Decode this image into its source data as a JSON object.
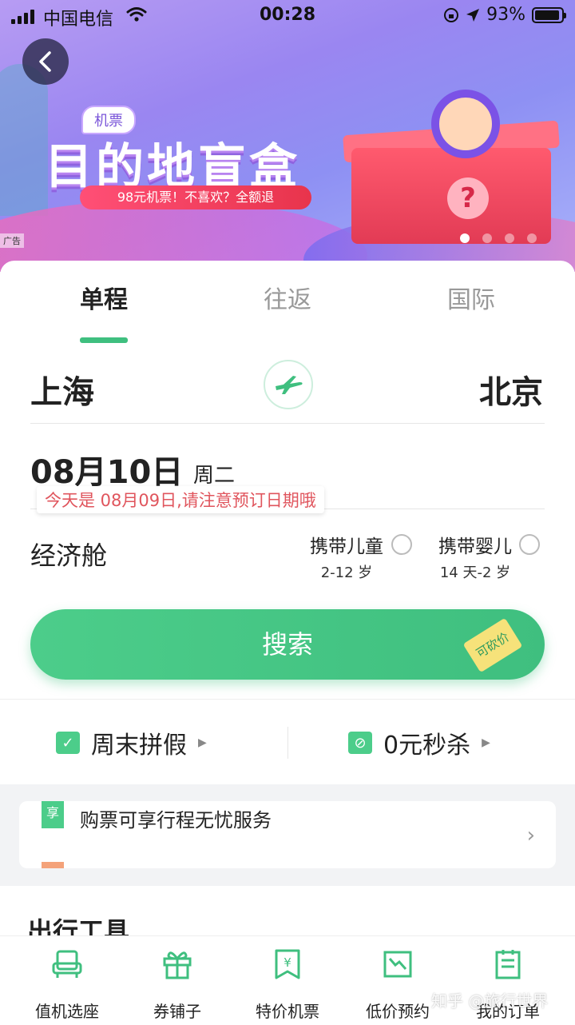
{
  "status_bar": {
    "carrier": "中国电信",
    "time": "00:28",
    "battery": "93%",
    "battery_level": 0.93
  },
  "banner": {
    "tag": "机票",
    "title": "目的地盲盒",
    "subtitle": "98元机票！不喜欢？全额退",
    "ad_label": "广告",
    "question_mark": "?",
    "page_count": 4,
    "active_page": 1
  },
  "tabs": [
    {
      "label": "单程",
      "active": true
    },
    {
      "label": "往返",
      "active": false
    },
    {
      "label": "国际",
      "active": false
    }
  ],
  "route": {
    "from": "上海",
    "to": "北京"
  },
  "date": {
    "value": "08月10日",
    "weekday": "周二",
    "notice": "今天是 08月09日,请注意预订日期哦"
  },
  "cabin": {
    "label": "经济舱"
  },
  "passenger_options": [
    {
      "label": "携带儿童",
      "age": "2-12 岁",
      "checked": false
    },
    {
      "label": "携带婴儿",
      "age": "14 天-2 岁",
      "checked": false
    }
  ],
  "search": {
    "label": "搜索",
    "badge": "可砍价"
  },
  "promos": [
    {
      "label": "周末拼假",
      "icon": "calendar-check-icon"
    },
    {
      "label": "0元秒杀",
      "icon": "discount-tag-icon"
    }
  ],
  "service": {
    "badge": "享",
    "text": "购票可享行程无忧服务"
  },
  "tools": {
    "title": "出行工具"
  },
  "bottom_nav": [
    {
      "label": "值机选座",
      "icon": "seat-icon"
    },
    {
      "label": "券铺子",
      "icon": "gift-icon"
    },
    {
      "label": "特价机票",
      "icon": "price-bookmark-icon"
    },
    {
      "label": "低价预约",
      "icon": "price-trend-icon"
    },
    {
      "label": "我的订单",
      "icon": "order-list-icon"
    }
  ],
  "watermark": "知乎 @旅行世界",
  "colors": {
    "accent": "#3fbf7f",
    "warning": "#e0555d",
    "banner": "#9a86f1"
  }
}
